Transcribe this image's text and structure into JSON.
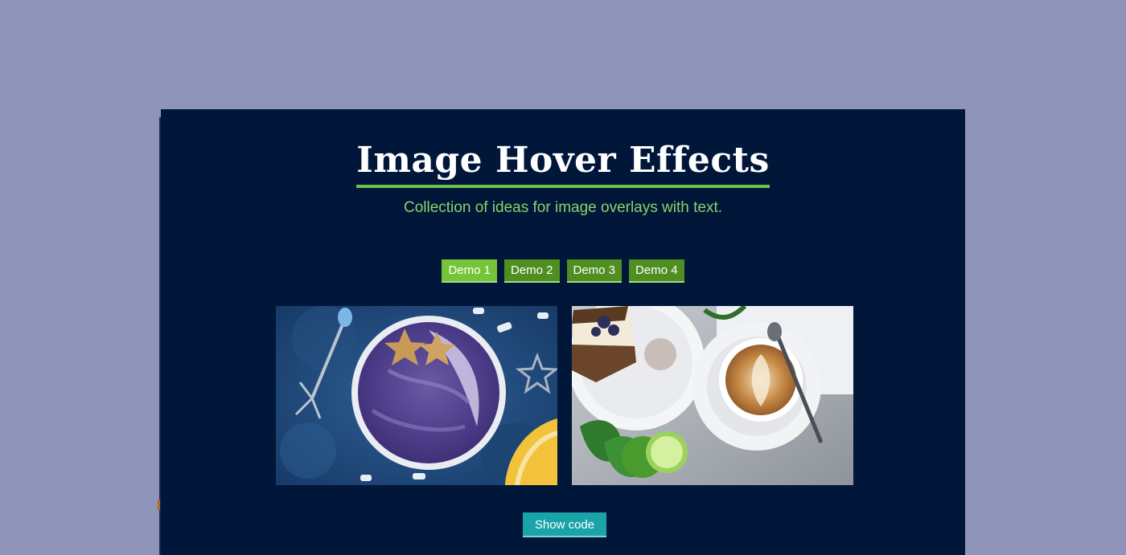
{
  "header": {
    "title": "Image Hover Effects",
    "subtitle": "Collection of ideas for image overlays with text."
  },
  "demo_tabs": [
    {
      "label": "Demo 1",
      "active": true
    },
    {
      "label": "Demo 2",
      "active": false
    },
    {
      "label": "Demo 3",
      "active": false
    },
    {
      "label": "Demo 4",
      "active": false
    }
  ],
  "gallery": {
    "images": [
      {
        "subject": "blueberry smoothie bowl with star fruit and banana on blue background"
      },
      {
        "subject": "cappuccino with latte art, cake slice, mint and lime"
      }
    ]
  },
  "footer": {
    "show_code_label": "Show code"
  },
  "colors": {
    "page_bg": "#8f95ba",
    "panel_bg": "#00173a",
    "accent_green": "#6cc24a",
    "tab_active": "#74c53a",
    "tab_inactive": "#4f8f22",
    "show_code_bg": "#1aa3a8"
  }
}
